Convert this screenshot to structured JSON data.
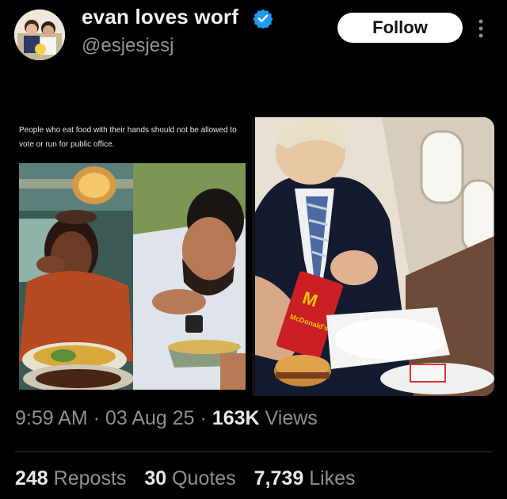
{
  "author": {
    "display_name": "evan loves worf",
    "handle": "@esjesjesj",
    "verified": true,
    "avatar_icon": "avatar-photo"
  },
  "follow_label": "Follow",
  "media": {
    "caption": "People who eat food with their hands should not be allowed to vote or run for public office.",
    "fries_box_text": "McDonald's"
  },
  "meta": {
    "time": "9:59 AM",
    "date": "03 Aug 25",
    "views_count": "163K",
    "views_label": "Views"
  },
  "stats": {
    "reposts_count": "248",
    "reposts_label": "Reposts",
    "quotes_count": "30",
    "quotes_label": "Quotes",
    "likes_count": "7,739",
    "likes_label": "Likes"
  },
  "colors": {
    "background": "#000000",
    "verified": "#1d9bf0",
    "text_secondary": "#8b9097"
  }
}
